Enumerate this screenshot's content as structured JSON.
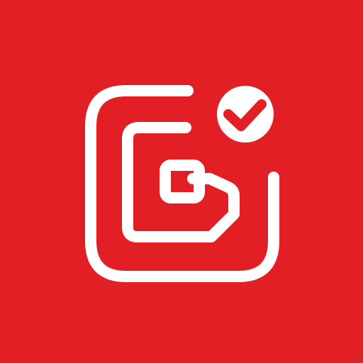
{
  "icon": {
    "name": "sim-card-verified-app-icon",
    "glyphs": [
      "rounded-frame-icon",
      "sim-chip-icon",
      "checkmark-badge-icon"
    ]
  },
  "colors": {
    "background": "#E31F26",
    "foreground": "#FFFFFF"
  }
}
